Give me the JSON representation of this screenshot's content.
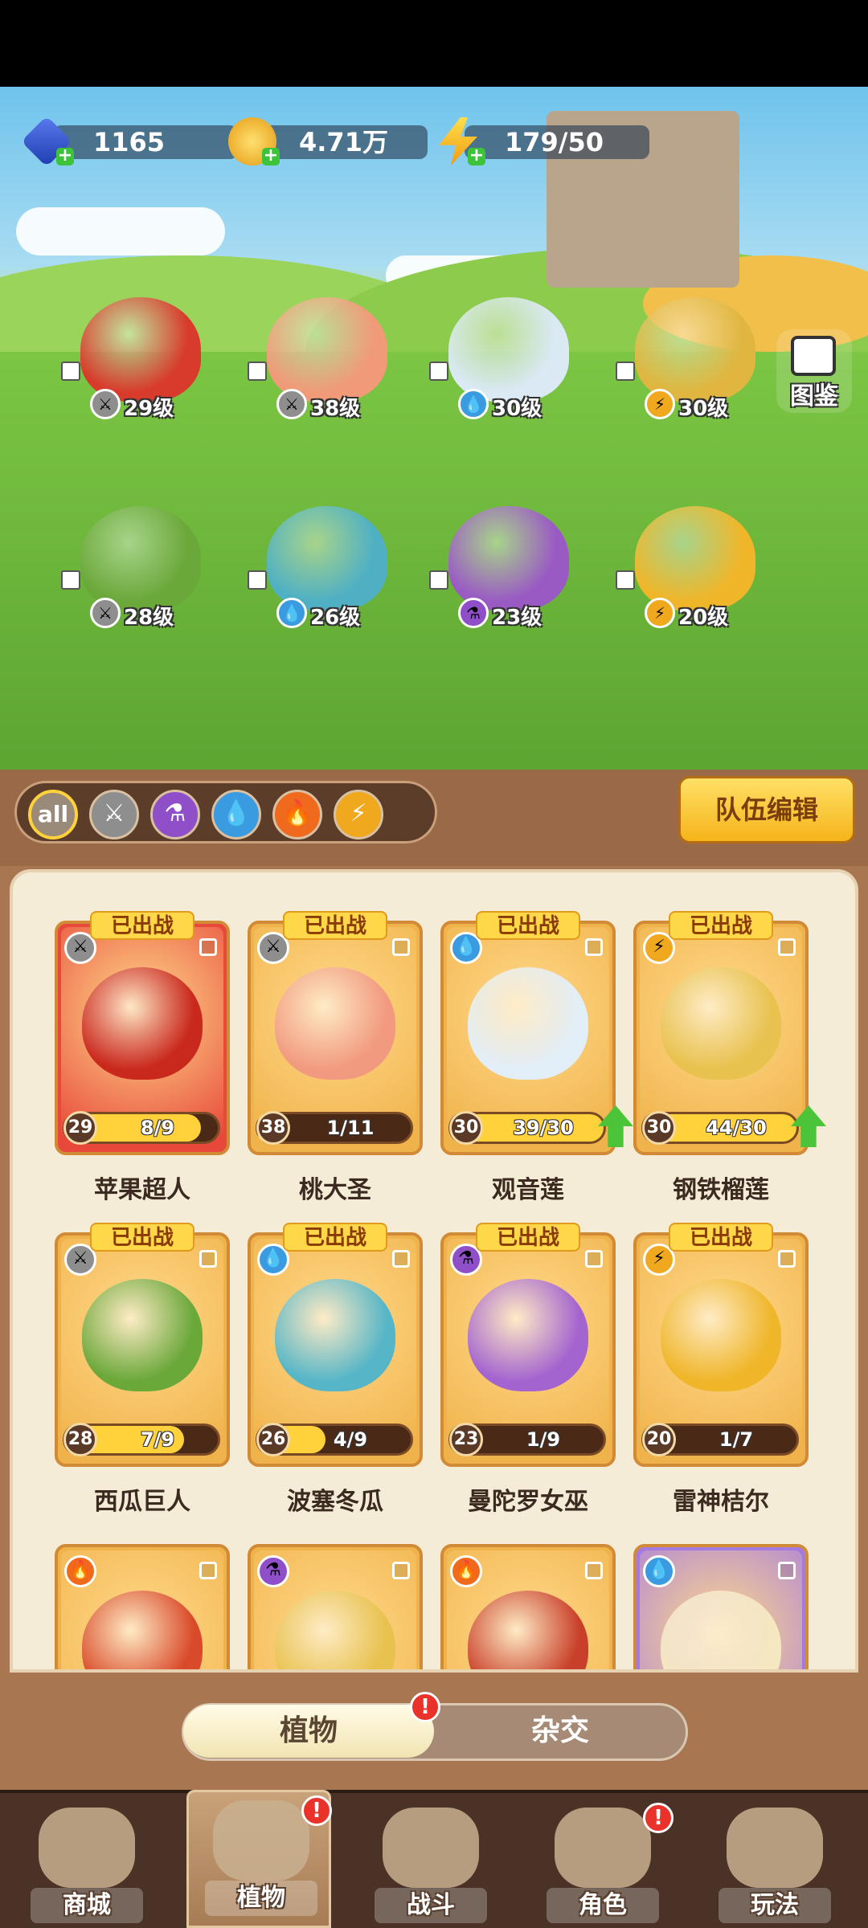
{
  "resources": {
    "gems": "1165",
    "coins": "4.71万",
    "energy": "179/50"
  },
  "codex_label": "图鉴",
  "field_plants": [
    {
      "name": "苹果超人",
      "level": "29级",
      "element": "sword",
      "color": "#d83a2c"
    },
    {
      "name": "桃大圣",
      "level": "38级",
      "element": "sword",
      "color": "#f19a78"
    },
    {
      "name": "观音莲",
      "level": "30级",
      "element": "water",
      "color": "#dbe9f5"
    },
    {
      "name": "钢铁榴莲",
      "level": "30级",
      "element": "thunder",
      "color": "#e0b640"
    },
    {
      "name": "西瓜巨人",
      "level": "28级",
      "element": "sword",
      "color": "#6aa83a"
    },
    {
      "name": "波塞冬瓜",
      "level": "26级",
      "element": "water",
      "color": "#4fb0c4"
    },
    {
      "name": "曼陀罗女巫",
      "level": "23级",
      "element": "poison",
      "color": "#9a5ac4"
    },
    {
      "name": "雷神桔尔",
      "level": "20级",
      "element": "thunder",
      "color": "#f0b62a"
    }
  ],
  "filters": [
    "all",
    "sword",
    "poison",
    "water",
    "fire",
    "thunder"
  ],
  "team_edit_label": "队伍编辑",
  "deployed_label": "已出战",
  "cards": [
    {
      "name": "苹果超人",
      "level": "29",
      "fragments": "8/9",
      "progress": 0.89,
      "element": "sword",
      "bg": "#e8483a",
      "color": "#c9291c",
      "deployed": true,
      "upgrade": false
    },
    {
      "name": "桃大圣",
      "level": "38",
      "fragments": "1/11",
      "progress": 0.09,
      "element": "sword",
      "bg": "#f0b24a",
      "color": "#f29a80",
      "deployed": true,
      "upgrade": false
    },
    {
      "name": "观音莲",
      "level": "30",
      "fragments": "39/30",
      "progress": 1.0,
      "element": "water",
      "bg": "#f0b24a",
      "color": "#e2eef8",
      "deployed": true,
      "upgrade": true
    },
    {
      "name": "钢铁榴莲",
      "level": "30",
      "fragments": "44/30",
      "progress": 1.0,
      "element": "thunder",
      "bg": "#f0b24a",
      "color": "#e8c24e",
      "deployed": true,
      "upgrade": true
    },
    {
      "name": "西瓜巨人",
      "level": "28",
      "fragments": "7/9",
      "progress": 0.78,
      "element": "sword",
      "bg": "#f0b24a",
      "color": "#6aa83a",
      "deployed": true,
      "upgrade": false
    },
    {
      "name": "波塞冬瓜",
      "level": "26",
      "fragments": "4/9",
      "progress": 0.44,
      "element": "water",
      "bg": "#f0b24a",
      "color": "#56b6c8",
      "deployed": true,
      "upgrade": false
    },
    {
      "name": "曼陀罗女巫",
      "level": "23",
      "fragments": "1/9",
      "progress": 0.11,
      "element": "poison",
      "bg": "#f0b24a",
      "color": "#a464d0",
      "deployed": true,
      "upgrade": false
    },
    {
      "name": "雷神桔尔",
      "level": "20",
      "fragments": "1/7",
      "progress": 0.14,
      "element": "thunder",
      "bg": "#f0b24a",
      "color": "#f0b62a",
      "deployed": true,
      "upgrade": false
    },
    {
      "name": "",
      "level": "",
      "fragments": "",
      "progress": 0,
      "element": "fire",
      "bg": "#f0b24a",
      "color": "#d94a2a",
      "deployed": false,
      "upgrade": false
    },
    {
      "name": "",
      "level": "",
      "fragments": "",
      "progress": 0,
      "element": "poison",
      "bg": "#f0b24a",
      "color": "#e8c24e",
      "deployed": false,
      "upgrade": false
    },
    {
      "name": "",
      "level": "",
      "fragments": "",
      "progress": 0,
      "element": "fire",
      "bg": "#f0b24a",
      "color": "#c9402a",
      "deployed": false,
      "upgrade": false
    },
    {
      "name": "",
      "level": "",
      "fragments": "",
      "progress": 0,
      "element": "water",
      "bg": "#a57ae0",
      "color": "#f5e7c0",
      "deployed": false,
      "upgrade": false
    }
  ],
  "tabs": {
    "plants": "植物",
    "hybrid": "杂交",
    "badge": "!"
  },
  "nav": [
    {
      "label": "商城",
      "badge": ""
    },
    {
      "label": "植物",
      "badge": "!"
    },
    {
      "label": "战斗",
      "badge": ""
    },
    {
      "label": "角色",
      "badge": "!"
    },
    {
      "label": "玩法",
      "badge": ""
    }
  ],
  "element_colors": {
    "sword": "#8e8e8e",
    "poison": "#8f4fc8",
    "water": "#3a9be0",
    "fire": "#f06a1e",
    "thunder": "#f0a81e"
  }
}
